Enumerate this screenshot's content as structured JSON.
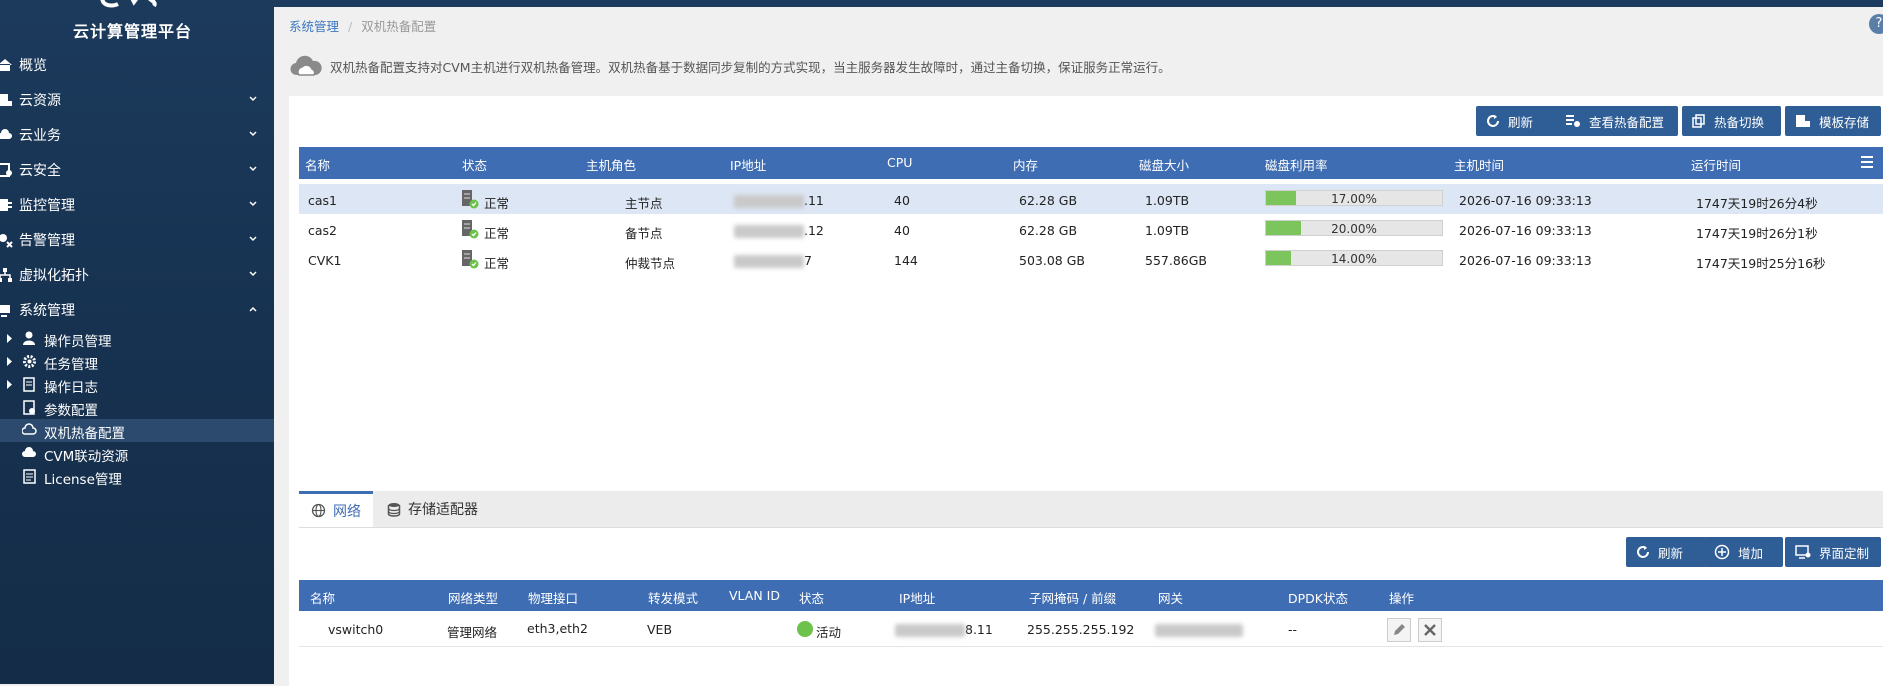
{
  "sidebar": {
    "logo_text": "云计算管理平台",
    "items": [
      {
        "label": "概览",
        "icon": "home-icon"
      },
      {
        "label": "云资源",
        "icon": "server-icon"
      },
      {
        "label": "云业务",
        "icon": "cloud-icon"
      },
      {
        "label": "云安全",
        "icon": "shield-icon"
      },
      {
        "label": "监控管理",
        "icon": "monitor-icon"
      },
      {
        "label": "告警管理",
        "icon": "alarm-icon"
      },
      {
        "label": "虚拟化拓扑",
        "icon": "topology-icon"
      },
      {
        "label": "系统管理",
        "icon": "system-icon"
      }
    ],
    "sub_items": [
      {
        "label": "操作员管理",
        "icon": "user-icon"
      },
      {
        "label": "任务管理",
        "icon": "gear-icon"
      },
      {
        "label": "操作日志",
        "icon": "log-icon"
      },
      {
        "label": "参数配置",
        "icon": "config-icon"
      },
      {
        "label": "双机热备配置",
        "icon": "cloud-icon"
      },
      {
        "label": "CVM联动资源",
        "icon": "cloud-link-icon"
      },
      {
        "label": "License管理",
        "icon": "license-icon"
      }
    ]
  },
  "breadcrumb": {
    "parent": "系统管理",
    "separator": "/",
    "current": "双机热备配置"
  },
  "info_text": "双机热备配置支持对CVM主机进行双机热备管理。双机热备基于数据同步复制的方式实现，当主服务器发生故障时，通过主备切换，保证服务正常运行。",
  "toolbar": {
    "refresh": "刷新",
    "view_config": "查看热备配置",
    "switch": "热备切换",
    "template_storage": "模板存储"
  },
  "host_table": {
    "columns": [
      "名称",
      "状态",
      "主机角色",
      "IP地址",
      "CPU",
      "内存",
      "磁盘大小",
      "磁盘利用率",
      "主机时间",
      "运行时间"
    ],
    "rows": [
      {
        "name": "cas1",
        "status": "正常",
        "role": "主节点",
        "ip_suffix": ".11",
        "cpu": "40",
        "memory": "62.28 GB",
        "disk": "1.09TB",
        "usage": 17,
        "usage_label": "17.00%",
        "host_time": "2026-07-16 09:33:13",
        "uptime": "1747天19时26分4秒"
      },
      {
        "name": "cas2",
        "status": "正常",
        "role": "备节点",
        "ip_suffix": ".12",
        "cpu": "40",
        "memory": "62.28 GB",
        "disk": "1.09TB",
        "usage": 20,
        "usage_label": "20.00%",
        "host_time": "2026-07-16 09:33:13",
        "uptime": "1747天19时26分1秒"
      },
      {
        "name": "CVK1",
        "status": "正常",
        "role": "仲裁节点",
        "ip_suffix": "7",
        "cpu": "144",
        "memory": "503.08 GB",
        "disk": "557.86GB",
        "usage": 14,
        "usage_label": "14.00%",
        "host_time": "2026-07-16 09:33:13",
        "uptime": "1747天19时25分16秒"
      }
    ]
  },
  "tabs": [
    {
      "label": "网络",
      "icon": "globe-icon"
    },
    {
      "label": "存储适配器",
      "icon": "database-icon"
    }
  ],
  "net_toolbar": {
    "refresh": "刷新",
    "add": "增加",
    "customize": "界面定制"
  },
  "net_table": {
    "columns": [
      "名称",
      "网络类型",
      "物理接口",
      "转发模式",
      "VLAN ID",
      "状态",
      "IP地址",
      "子网掩码 / 前缀",
      "网关",
      "DPDK状态",
      "操作"
    ],
    "rows": [
      {
        "name": "vswitch0",
        "type": "管理网络",
        "iface": "eth3,eth2",
        "mode": "VEB",
        "vlan": "",
        "status": "活动",
        "ip_suffix": "8.11",
        "mask": "255.255.255.192",
        "dpdk": "--"
      }
    ]
  },
  "colors": {
    "sidebar": "#1c3a5c",
    "header": "#3f6db3",
    "button": "#2f5d95",
    "progress": "#7cc55d",
    "active": "#6cc24a"
  }
}
